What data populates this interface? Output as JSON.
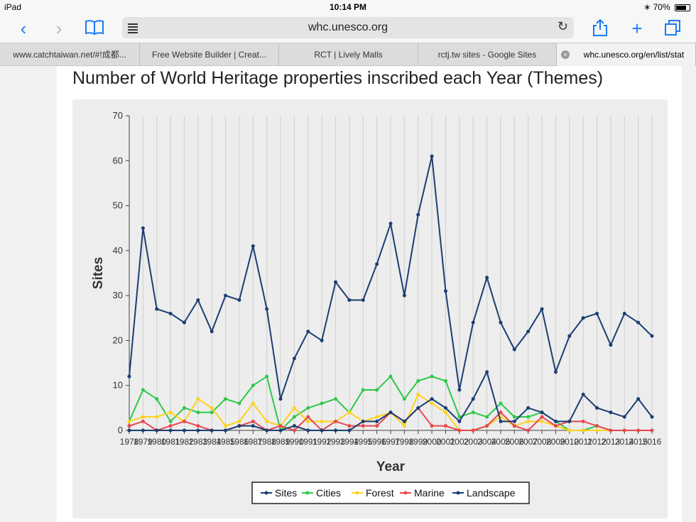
{
  "status": {
    "device": "iPad",
    "time": "10:14 PM",
    "battery": "70%"
  },
  "toolbar": {
    "url": "whc.unesco.org"
  },
  "tabs": [
    {
      "label": "www.catchtaiwan.net/#!成都..."
    },
    {
      "label": "Free Website Builder | Creat..."
    },
    {
      "label": "RCT | Lively Malls"
    },
    {
      "label": "rctj.tw sites - Google Sites"
    },
    {
      "label": "whc.unesco.org/en/list/stat"
    }
  ],
  "page": {
    "title": "Number of World Heritage properties inscribed each Year (Themes)"
  },
  "colors": {
    "Sites": "#1b3e72",
    "Cities": "#2ec84a",
    "Forest": "#ffd21e",
    "Marine": "#e8474e",
    "Landscape": "#1b3e72",
    "accent": "#1a7cf5"
  },
  "chart_data": {
    "type": "line",
    "xlabel": "Year",
    "ylabel": "Sites",
    "ylim": [
      0,
      70
    ],
    "yticks": [
      0,
      10,
      20,
      30,
      40,
      50,
      60,
      70
    ],
    "grid": "vertical",
    "legend": "bottom",
    "x": [
      1978,
      1979,
      1980,
      1981,
      1982,
      1983,
      1984,
      1985,
      1986,
      1987,
      1988,
      1989,
      1990,
      1991,
      1992,
      1993,
      1994,
      1995,
      1996,
      1997,
      1998,
      1999,
      2000,
      2001,
      2002,
      2003,
      2004,
      2005,
      2006,
      2007,
      2008,
      2009,
      2010,
      2011,
      2012,
      2013,
      2014,
      2015,
      2016
    ],
    "series": [
      {
        "name": "Sites",
        "values": [
          12,
          45,
          27,
          26,
          24,
          29,
          22,
          30,
          29,
          41,
          27,
          7,
          16,
          22,
          20,
          33,
          29,
          29,
          37,
          46,
          30,
          48,
          61,
          31,
          9,
          24,
          34,
          24,
          18,
          22,
          27,
          13,
          21,
          25,
          26,
          19,
          26,
          24,
          21
        ]
      },
      {
        "name": "Cities",
        "values": [
          2,
          9,
          7,
          2,
          5,
          4,
          4,
          7,
          6,
          10,
          12,
          0,
          3,
          5,
          6,
          7,
          4,
          9,
          9,
          12,
          7,
          11,
          12,
          11,
          3,
          4,
          3,
          6,
          3,
          3,
          4,
          2,
          0,
          0,
          1,
          0,
          0,
          0,
          0
        ]
      },
      {
        "name": "Forest",
        "values": [
          2,
          3,
          3,
          4,
          2,
          7,
          5,
          1,
          2,
          6,
          2,
          1,
          5,
          2,
          2,
          2,
          4,
          2,
          3,
          4,
          1,
          8,
          6,
          4,
          0,
          0,
          1,
          3,
          1,
          2,
          2,
          1,
          0,
          0,
          0,
          0,
          0,
          0,
          0
        ]
      },
      {
        "name": "Marine",
        "values": [
          1,
          2,
          0,
          1,
          2,
          1,
          0,
          0,
          1,
          2,
          0,
          1,
          0,
          3,
          0,
          2,
          1,
          1,
          1,
          4,
          2,
          5,
          1,
          1,
          0,
          0,
          1,
          4,
          1,
          0,
          3,
          1,
          2,
          2,
          1,
          0,
          0,
          0,
          0
        ]
      },
      {
        "name": "Landscape",
        "values": [
          0,
          0,
          0,
          0,
          0,
          0,
          0,
          0,
          1,
          1,
          0,
          0,
          1,
          0,
          0,
          0,
          0,
          2,
          2,
          4,
          2,
          5,
          7,
          5,
          2,
          7,
          13,
          2,
          2,
          5,
          4,
          2,
          2,
          8,
          5,
          4,
          3,
          7,
          3
        ]
      }
    ],
    "x_tick_labels": [
      "1978",
      "1979",
      "1980",
      "1981",
      "1982",
      "1983",
      "1984",
      "1985",
      "1986",
      "1987",
      "1988",
      "1989",
      "1990",
      "1991",
      "1992",
      "1993",
      "1994",
      "1995",
      "1996",
      "1997",
      "1998",
      "1999",
      "2000",
      "2001",
      "2002",
      "2003",
      "2004",
      "2005",
      "2006",
      "2007",
      "2008",
      "2009",
      "2010",
      "2011",
      "2012",
      "2013",
      "2014",
      "2015",
      "2016"
    ]
  }
}
